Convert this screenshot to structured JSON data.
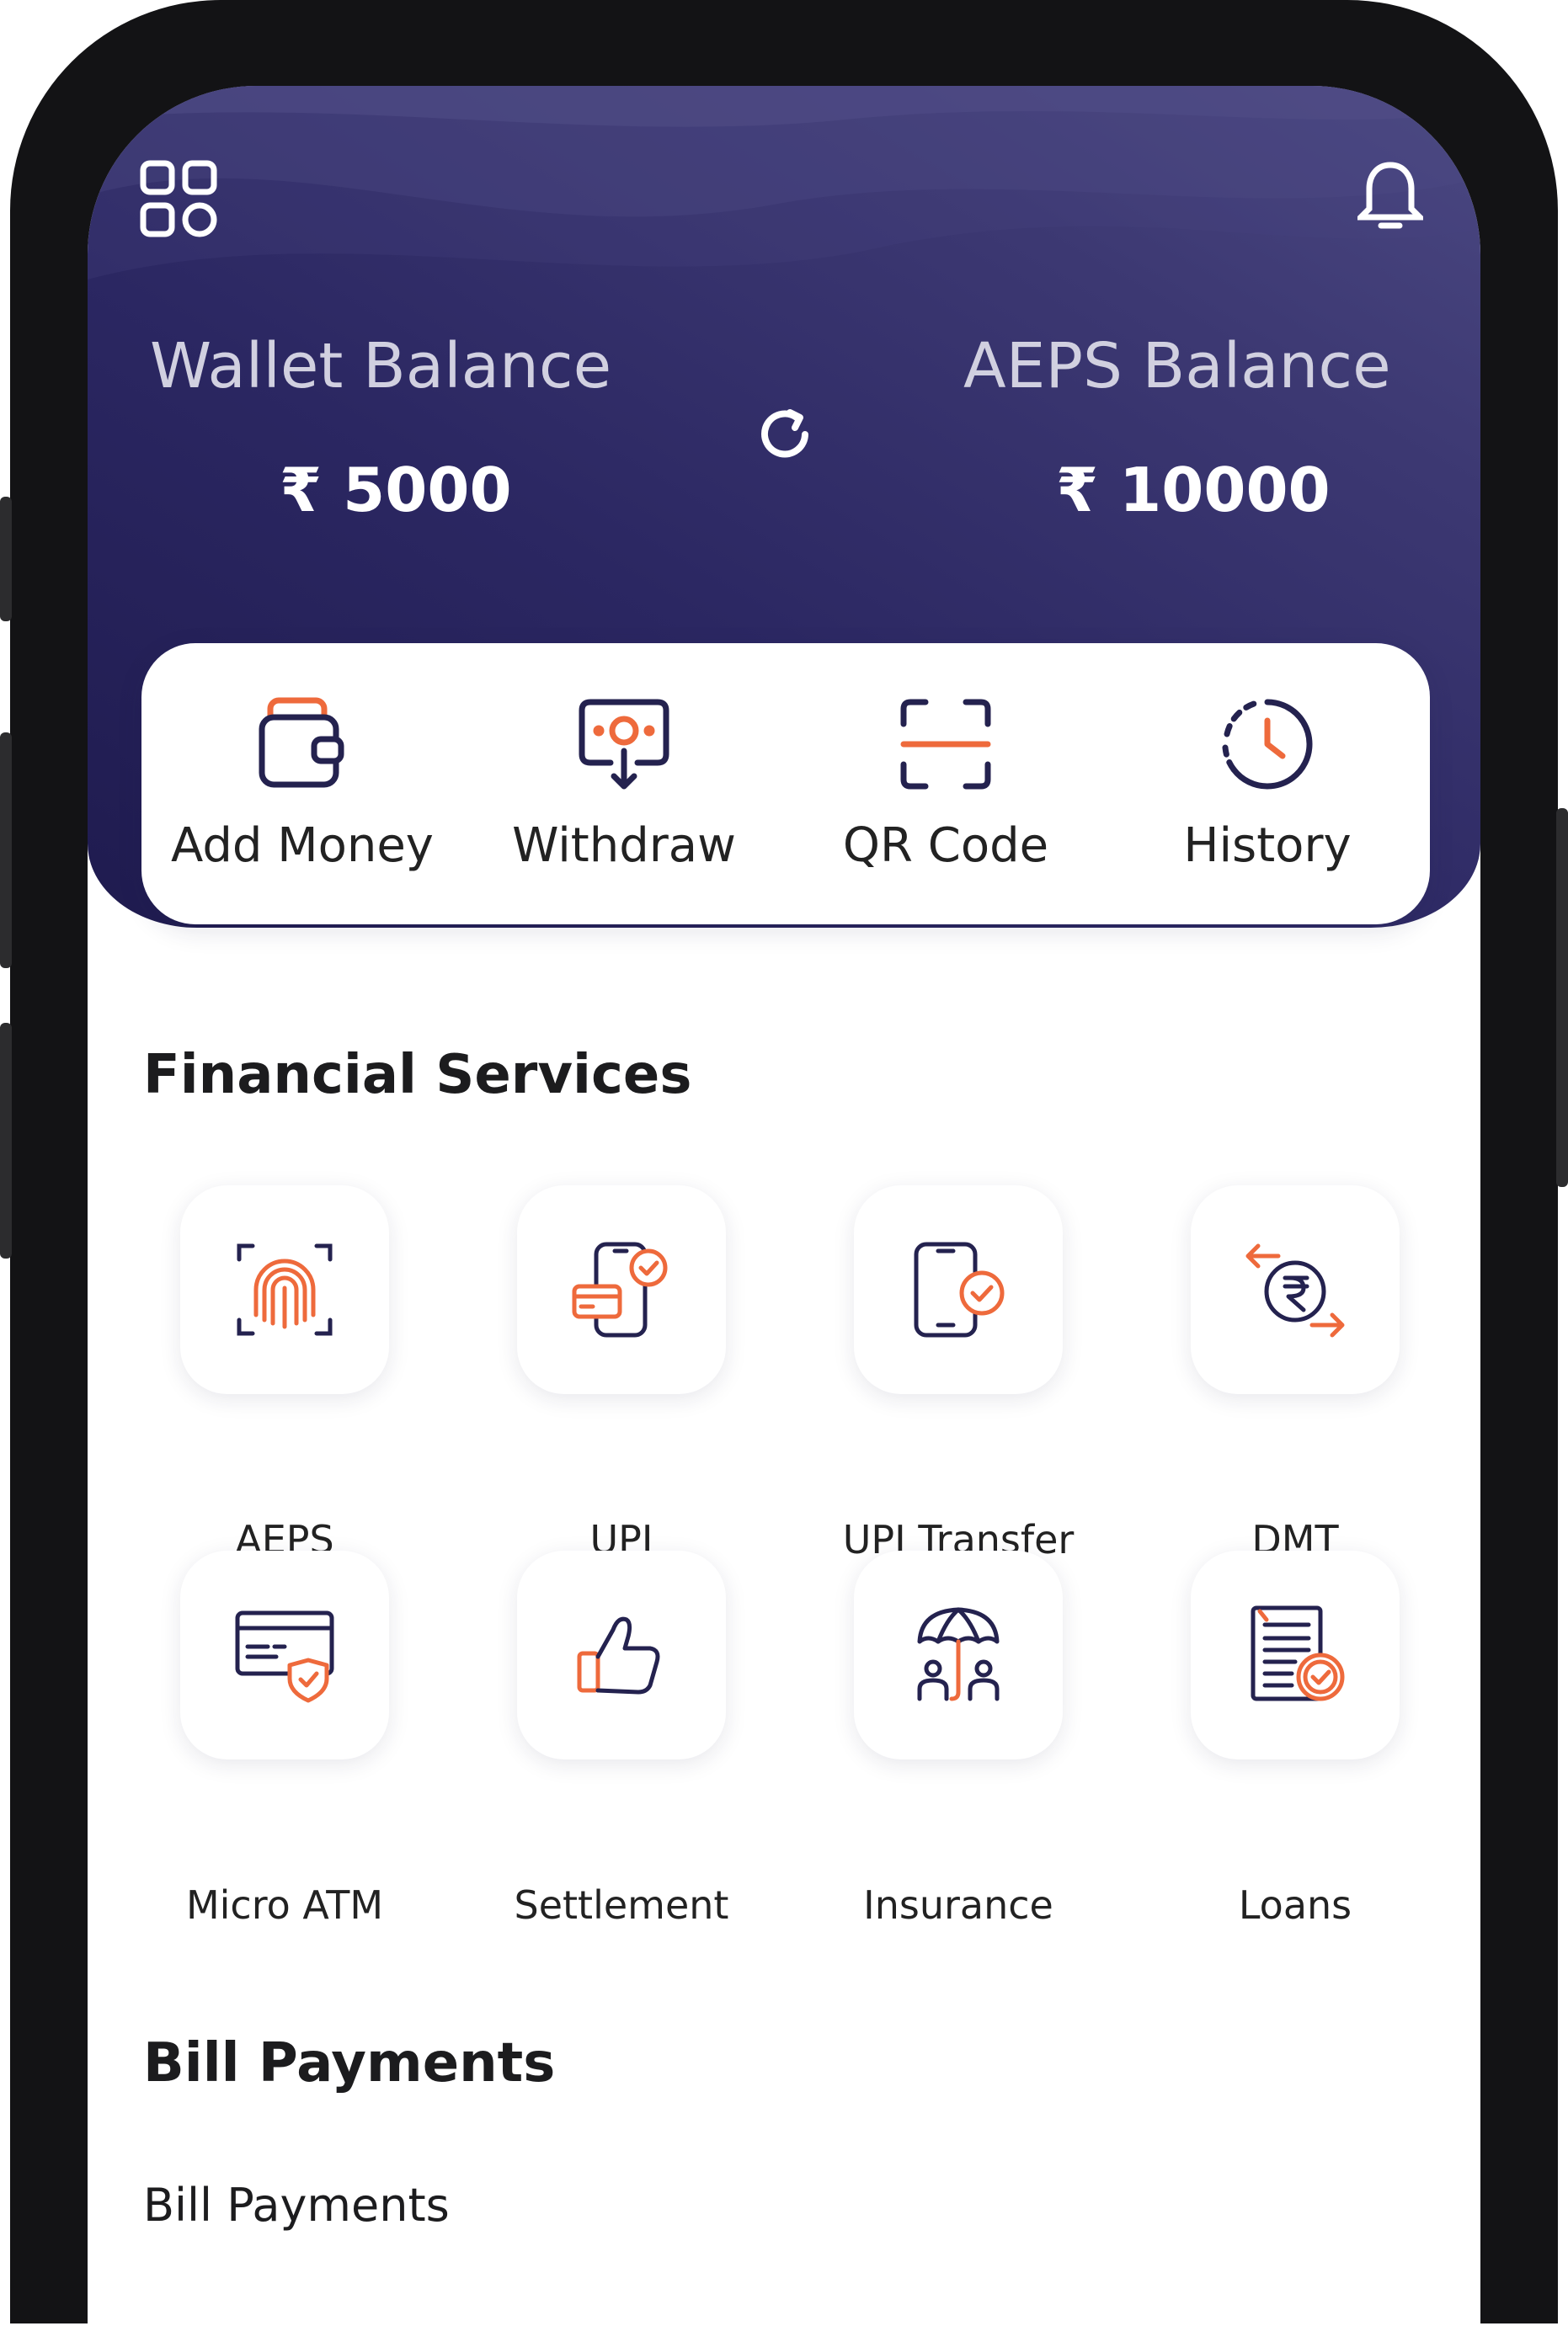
{
  "header": {
    "wallet": {
      "label": "Wallet Balance",
      "value": "₹ 5000"
    },
    "aeps": {
      "label": "AEPS Balance",
      "value": "₹ 10000"
    }
  },
  "quick_actions": [
    {
      "label": "Add Money",
      "icon": "wallet-icon"
    },
    {
      "label": "Withdraw",
      "icon": "withdraw-icon"
    },
    {
      "label": "QR Code",
      "icon": "qr-scan-icon"
    },
    {
      "label": "History",
      "icon": "clock-icon"
    }
  ],
  "financial_services": {
    "title": "Financial Services",
    "items": [
      {
        "label": "AEPS",
        "icon": "fingerprint-icon"
      },
      {
        "label": "UPI",
        "icon": "phone-card-icon"
      },
      {
        "label": "UPI Transfer",
        "icon": "phone-check-icon"
      },
      {
        "label": "DMT",
        "icon": "rupee-transfer-icon"
      },
      {
        "label": "Micro ATM",
        "icon": "card-shield-icon"
      },
      {
        "label": "Settlement",
        "icon": "thumbs-up-icon"
      },
      {
        "label": "Insurance",
        "icon": "umbrella-family-icon"
      },
      {
        "label": "Loans",
        "icon": "document-check-icon"
      }
    ]
  },
  "bill_payments": {
    "title": "Bill Payments",
    "subtitle": "Bill Payments"
  },
  "colors": {
    "header_start": "#1f1b4f",
    "header_end": "#4b4882",
    "icon_navy": "#24224f",
    "icon_orange": "#ee6a3c",
    "text_dark": "#1c1c1e"
  }
}
